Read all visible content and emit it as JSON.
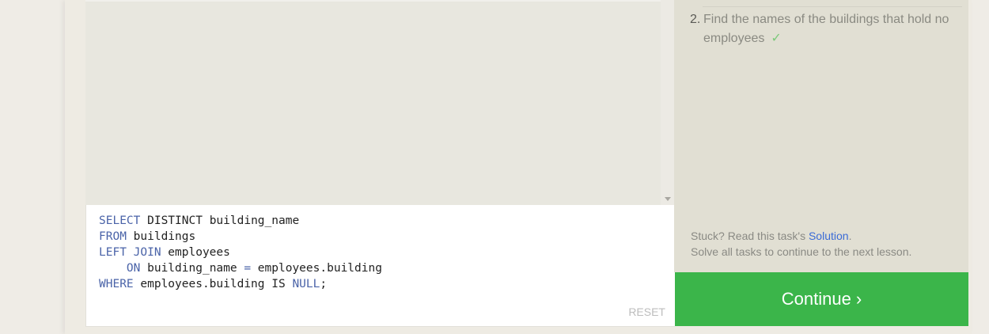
{
  "editor": {
    "lines": [
      [
        {
          "t": "SELECT",
          "k": "kw"
        },
        {
          "t": " DISTINCT building_name",
          "k": ""
        }
      ],
      [
        {
          "t": "FROM",
          "k": "kw"
        },
        {
          "t": " buildings",
          "k": ""
        }
      ],
      [
        {
          "t": "LEFT JOIN",
          "k": "kw"
        },
        {
          "t": " employees",
          "k": ""
        }
      ],
      [
        {
          "t": "    ",
          "k": ""
        },
        {
          "t": "ON",
          "k": "kw"
        },
        {
          "t": " building_name ",
          "k": ""
        },
        {
          "t": "=",
          "k": "op"
        },
        {
          "t": " employees.building",
          "k": ""
        }
      ],
      [
        {
          "t": "WHERE",
          "k": "kw"
        },
        {
          "t": " employees.building IS ",
          "k": ""
        },
        {
          "t": "NULL",
          "k": "kw"
        },
        {
          "t": ";",
          "k": ""
        }
      ]
    ],
    "reset_label": "RESET"
  },
  "sidebar": {
    "task": {
      "number": "2.",
      "text": "Find the names of the buildings that hold no employees",
      "check": "✓"
    },
    "help": {
      "stuck_prefix": "Stuck? Read this task's ",
      "solution_link": "Solution",
      "stuck_suffix": ".",
      "note": "Solve all tasks to continue to the next lesson."
    },
    "continue_label": "Continue ›"
  },
  "colors": {
    "continue_bg": "#3bb54a",
    "keyword": "#4a63a8",
    "link": "#3a6bd6",
    "check": "#7cc97a"
  }
}
